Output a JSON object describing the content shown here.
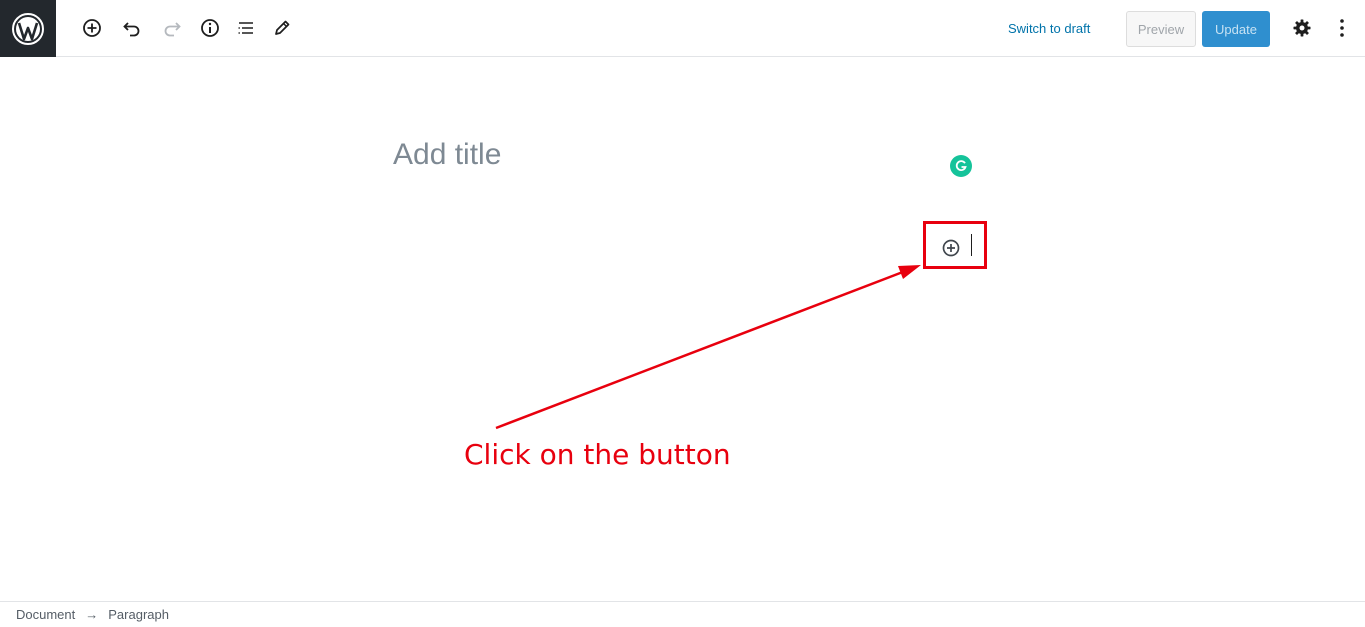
{
  "toolbar": {
    "logo": "wordpress-logo",
    "tools": [
      {
        "name": "add-block-icon"
      },
      {
        "name": "undo-icon"
      },
      {
        "name": "redo-icon"
      },
      {
        "name": "info-icon"
      },
      {
        "name": "block-navigation-icon"
      },
      {
        "name": "edit-pencil-icon"
      }
    ],
    "switch_to_draft": "Switch to draft",
    "preview": "Preview",
    "update": "Update",
    "settings_icon": "gear-icon",
    "more_icon": "more-vertical-icon"
  },
  "editor": {
    "title_placeholder": "Add title",
    "grammarly_icon": "grammarly-icon",
    "inserter_icon": "add-block-icon"
  },
  "annotation": {
    "text": "Click on the button",
    "color": "#e8000e"
  },
  "footer": {
    "breadcrumb": [
      "Document",
      "→",
      "Paragraph"
    ]
  },
  "colors": {
    "link": "#0073aa",
    "update_bg": "#2f8fcf",
    "logo_bg": "#23282d",
    "grammarly": "#15c39a"
  }
}
